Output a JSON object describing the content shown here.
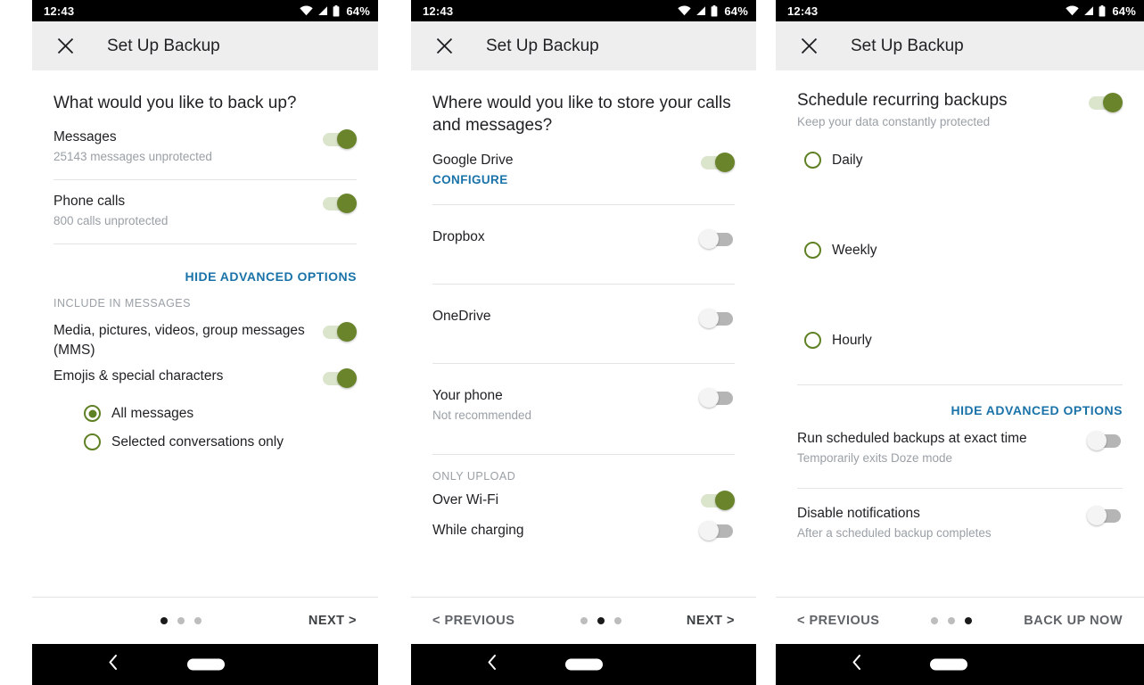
{
  "statusbar": {
    "time": "12:43",
    "battery": "64%",
    "icons": [
      "wifi-icon",
      "signal-icon",
      "battery-icon"
    ]
  },
  "appbar": {
    "title": "Set Up Backup",
    "close_icon": "close-icon"
  },
  "colors": {
    "accent_green": "#69842b",
    "radio_green": "#5f8023",
    "track_on": "#dbe5cc",
    "track_off": "#b5b5b5",
    "link_blue": "#1a73a8",
    "appbar_bg": "#eeeeee",
    "secondary_text": "#9aa0a6"
  },
  "screen1": {
    "question": "What would you like to back up?",
    "items": [
      {
        "title": "Messages",
        "subtitle": "25143 messages unprotected",
        "toggle": "on"
      },
      {
        "title": "Phone calls",
        "subtitle": "800 calls unprotected",
        "toggle": "on"
      }
    ],
    "hide_advanced": "HIDE ADVANCED OPTIONS",
    "section_label": "INCLUDE IN MESSAGES",
    "advanced": [
      {
        "title": "Media, pictures, videos, group messages (MMS)",
        "toggle": "on"
      },
      {
        "title": "Emojis & special characters",
        "toggle": "on"
      }
    ],
    "radios": [
      {
        "label": "All messages",
        "checked": true
      },
      {
        "label": "Selected conversations only",
        "checked": false
      }
    ],
    "footer": {
      "previous": "",
      "next": "NEXT >",
      "dots": [
        true,
        false,
        false
      ]
    }
  },
  "screen2": {
    "question": "Where would you like to store your calls and messages?",
    "items": [
      {
        "title": "Google Drive",
        "link": "CONFIGURE",
        "toggle": "on"
      },
      {
        "title": "Dropbox",
        "toggle": "off"
      },
      {
        "title": "OneDrive",
        "toggle": "off"
      },
      {
        "title": "Your phone",
        "subtitle": "Not recommended",
        "toggle": "off"
      }
    ],
    "section_label": "ONLY UPLOAD",
    "upload": [
      {
        "title": "Over Wi-Fi",
        "toggle": "on"
      },
      {
        "title": "While charging",
        "toggle": "off"
      }
    ],
    "footer": {
      "previous": "< PREVIOUS",
      "next": "NEXT >",
      "dots": [
        false,
        true,
        false
      ]
    }
  },
  "screen3": {
    "header": {
      "title": "Schedule recurring backups",
      "subtitle": "Keep your data constantly protected",
      "toggle": "on"
    },
    "radios": [
      {
        "label": "Daily",
        "checked": false
      },
      {
        "label": "Weekly",
        "checked": false
      },
      {
        "label": "Hourly",
        "checked": false
      }
    ],
    "hide_advanced": "HIDE ADVANCED OPTIONS",
    "advanced": [
      {
        "title": "Run scheduled backups at exact time",
        "subtitle": "Temporarily exits Doze mode",
        "toggle": "off"
      },
      {
        "title": "Disable notifications",
        "subtitle": "After a scheduled backup completes",
        "toggle": "off"
      }
    ],
    "footer": {
      "previous": "< PREVIOUS",
      "next": "BACK UP NOW",
      "dots": [
        false,
        false,
        true
      ]
    }
  },
  "sysnav": {
    "back_icon": "back-chevron-icon",
    "home_pill": "home-pill-icon"
  }
}
